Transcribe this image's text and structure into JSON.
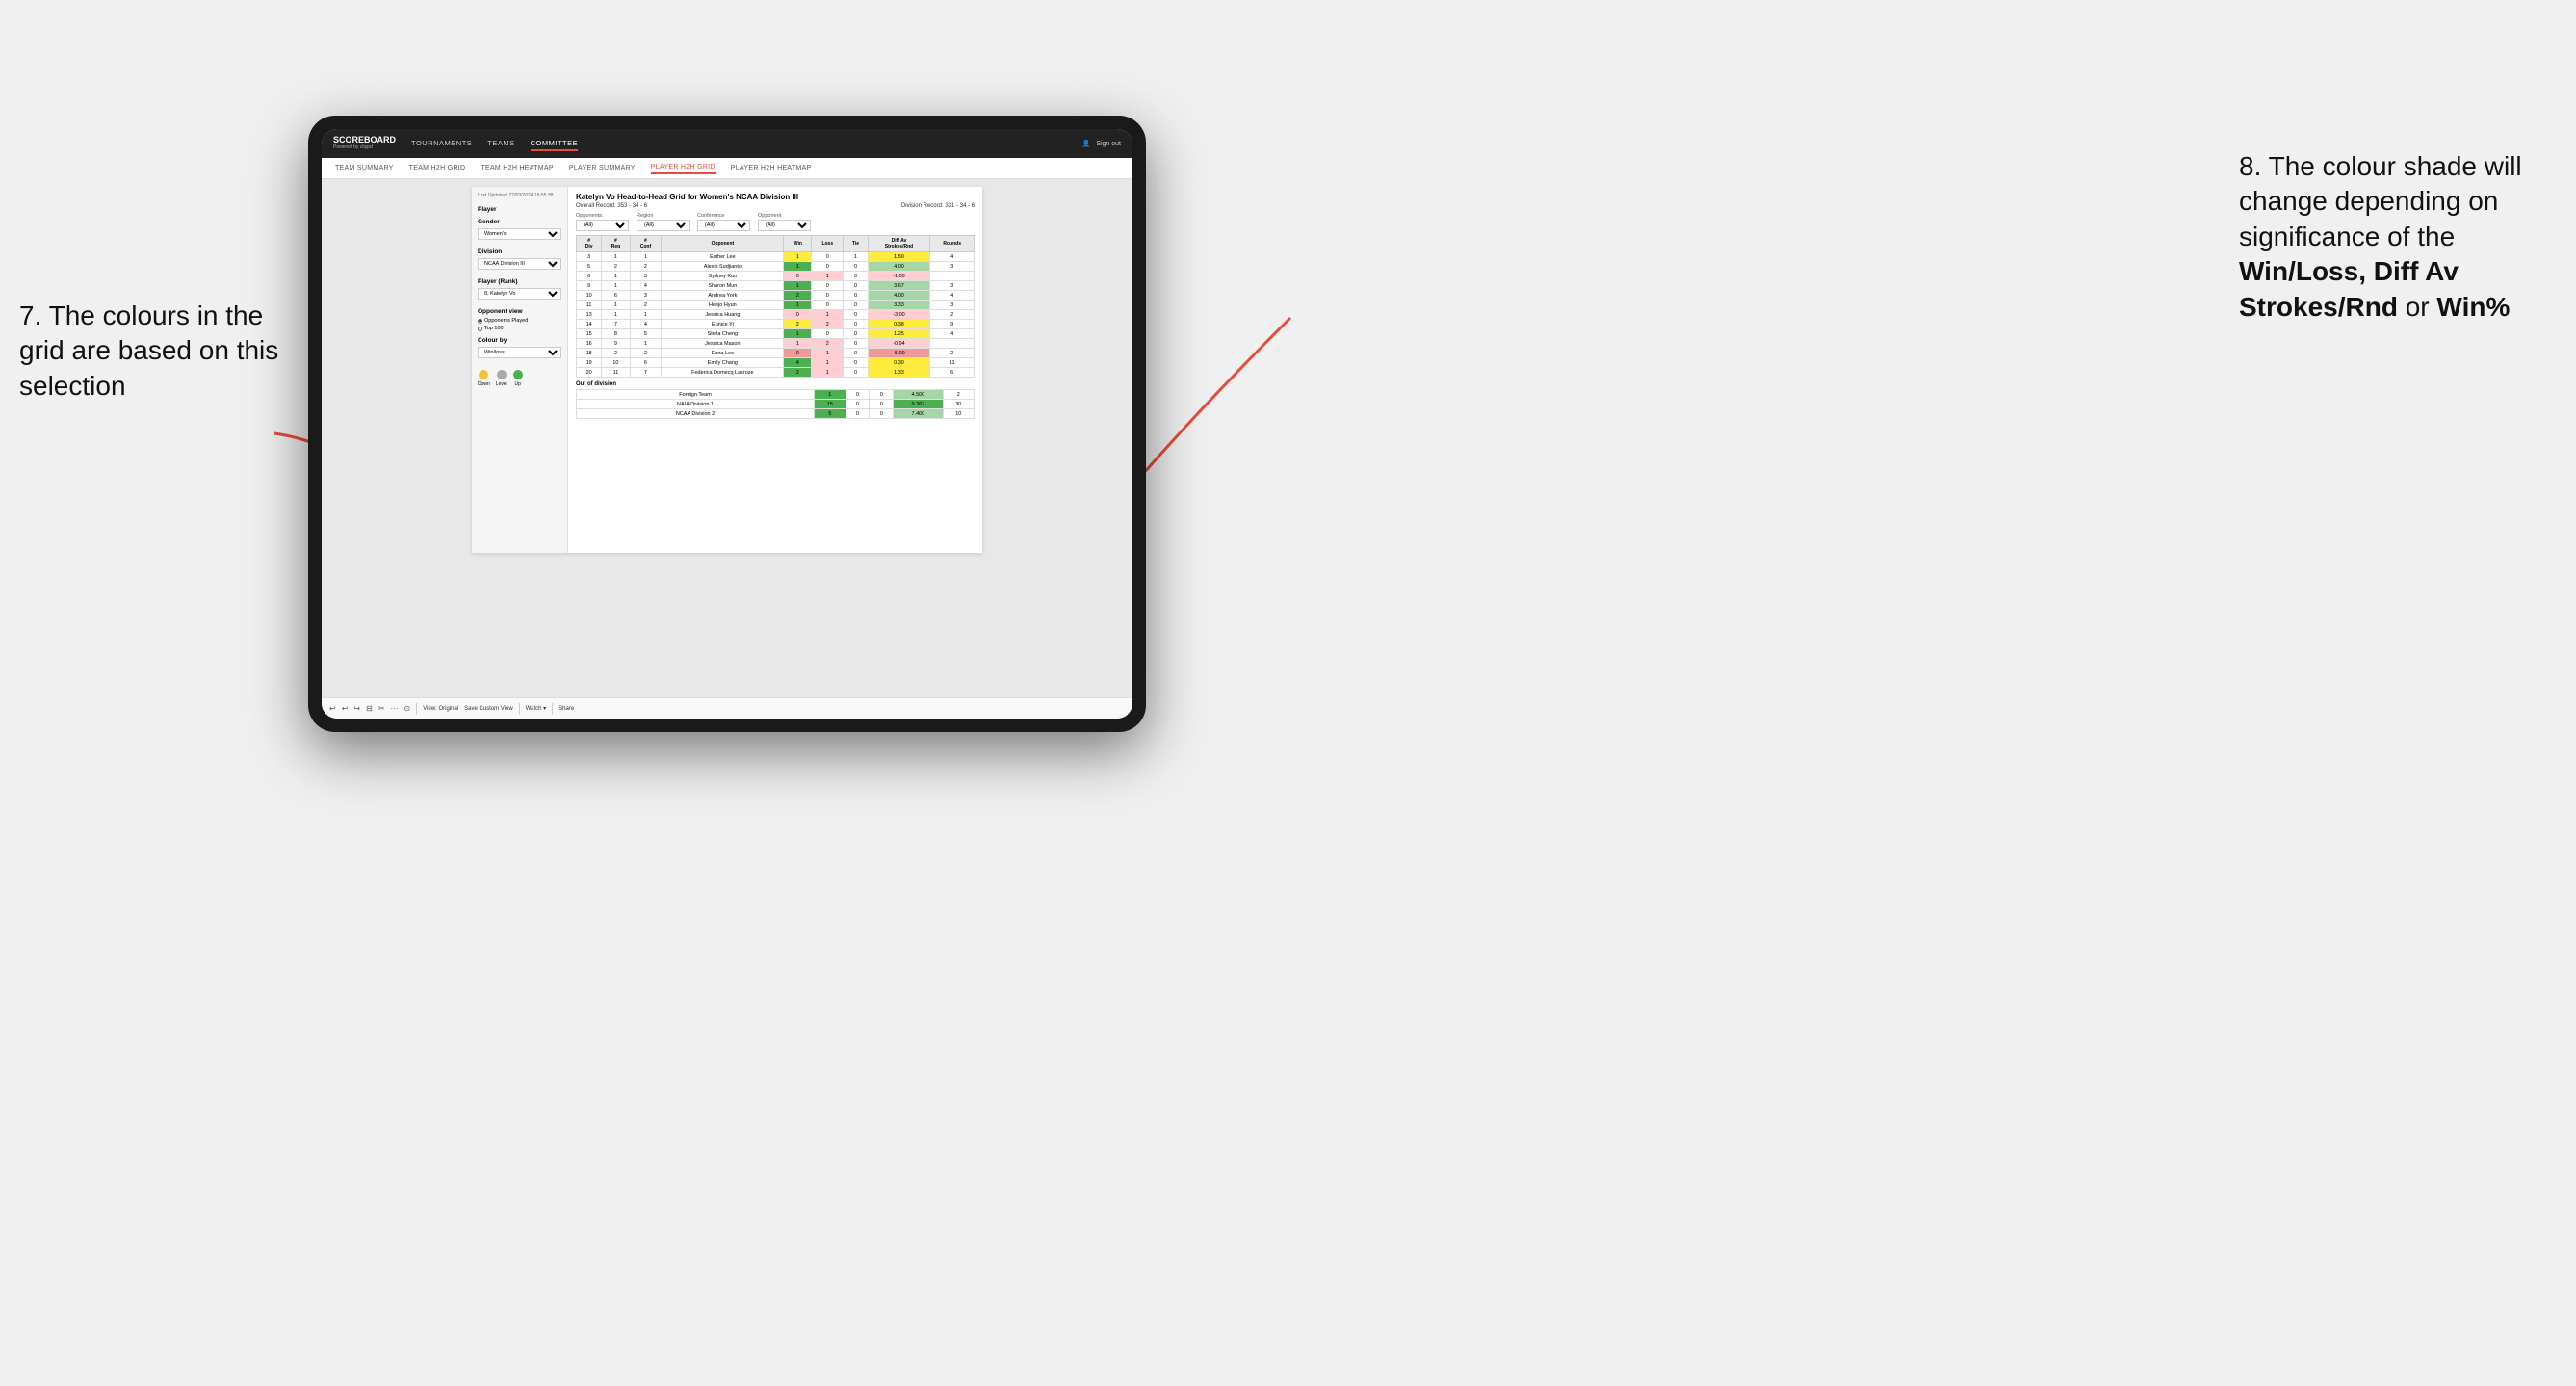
{
  "annotations": {
    "left_title": "7. The colours in the grid are based on this selection",
    "right_title": "8. The colour shade will change depending on significance of the",
    "right_bold1": "Win/Loss,",
    "right_bold2": "Diff Av Strokes/Rnd",
    "right_bold3": "or",
    "right_bold4": "Win%"
  },
  "nav": {
    "logo": "SCOREBOARD",
    "powered": "Powered by clippd",
    "links": [
      "TOURNAMENTS",
      "TEAMS",
      "COMMITTEE"
    ],
    "active_link": "COMMITTEE",
    "sign_in": "Sign out"
  },
  "sub_nav": {
    "links": [
      "TEAM SUMMARY",
      "TEAM H2H GRID",
      "TEAM H2H HEATMAP",
      "PLAYER SUMMARY",
      "PLAYER H2H GRID",
      "PLAYER H2H HEATMAP"
    ],
    "active": "PLAYER H2H GRID"
  },
  "sidebar": {
    "timestamp": "Last Updated: 27/03/2024 16:55:38",
    "sections": {
      "player": "Player",
      "gender_label": "Gender",
      "gender_value": "Women's",
      "division_label": "Division",
      "division_value": "NCAA Division III",
      "player_rank_label": "Player (Rank)",
      "player_rank_value": "8. Katelyn Vo"
    },
    "opponent_view": {
      "label": "Opponent view",
      "options": [
        "Opponents Played",
        "Top 100"
      ],
      "selected": "Opponents Played"
    },
    "colour_by": {
      "label": "Colour by",
      "value": "Win/loss"
    },
    "legend": {
      "items": [
        {
          "color": "#f4c430",
          "label": "Down"
        },
        {
          "color": "#aaaaaa",
          "label": "Level"
        },
        {
          "color": "#4CAF50",
          "label": "Up"
        }
      ]
    }
  },
  "report": {
    "title": "Katelyn Vo Head-to-Head Grid for Women's NCAA Division III",
    "overall_record_label": "Overall Record:",
    "overall_record": "353 - 34 - 6",
    "division_record_label": "Division Record:",
    "division_record": "331 - 34 - 6",
    "filters": {
      "opponents_label": "Opponents:",
      "opponents_value": "(All)",
      "region_label": "Region",
      "region_value": "(All)",
      "conference_label": "Conference",
      "conference_value": "(All)",
      "opponent_label": "Opponent",
      "opponent_value": "(All)"
    },
    "table_headers": [
      "#\nDiv",
      "#\nReg",
      "#\nConf",
      "Opponent",
      "Win",
      "Loss",
      "Tie",
      "Diff Av\nStrokes/Rnd",
      "Rounds"
    ],
    "rows": [
      {
        "div": 3,
        "reg": 1,
        "conf": 1,
        "opponent": "Esther Lee",
        "win": 1,
        "loss": 0,
        "tie": 1,
        "diff": "1.50",
        "rounds": 4,
        "win_color": "yellow",
        "diff_color": "yellow"
      },
      {
        "div": 5,
        "reg": 2,
        "conf": 2,
        "opponent": "Alexis Sudjianto",
        "win": 1,
        "loss": 0,
        "tie": 0,
        "diff": "4.00",
        "rounds": 3,
        "win_color": "green-dark",
        "diff_color": "green-light"
      },
      {
        "div": 6,
        "reg": 1,
        "conf": 3,
        "opponent": "Sydney Kuo",
        "win": 0,
        "loss": 1,
        "tie": 0,
        "diff": "-1.00",
        "rounds": "",
        "win_color": "red-light",
        "diff_color": "red-light"
      },
      {
        "div": 9,
        "reg": 1,
        "conf": 4,
        "opponent": "Sharon Mun",
        "win": 1,
        "loss": 0,
        "tie": 0,
        "diff": "3.67",
        "rounds": 3,
        "win_color": "green-dark",
        "diff_color": "green-light"
      },
      {
        "div": 10,
        "reg": 6,
        "conf": 3,
        "opponent": "Andrea York",
        "win": 2,
        "loss": 0,
        "tie": 0,
        "diff": "4.00",
        "rounds": 4,
        "win_color": "green-dark",
        "diff_color": "green-light"
      },
      {
        "div": 11,
        "reg": 1,
        "conf": 2,
        "opponent": "Heejo Hyun",
        "win": 1,
        "loss": 0,
        "tie": 0,
        "diff": "3.33",
        "rounds": 3,
        "win_color": "green-dark",
        "diff_color": "green-light"
      },
      {
        "div": 13,
        "reg": 1,
        "conf": 1,
        "opponent": "Jessica Huang",
        "win": 0,
        "loss": 1,
        "tie": 0,
        "diff": "-3.00",
        "rounds": 2,
        "win_color": "red-light",
        "diff_color": "red-light"
      },
      {
        "div": 14,
        "reg": 7,
        "conf": 4,
        "opponent": "Eunice Yi",
        "win": 2,
        "loss": 2,
        "tie": 0,
        "diff": "0.38",
        "rounds": 9,
        "win_color": "yellow",
        "diff_color": "yellow"
      },
      {
        "div": 15,
        "reg": 8,
        "conf": 5,
        "opponent": "Stella Cheng",
        "win": 1,
        "loss": 0,
        "tie": 0,
        "diff": "1.25",
        "rounds": 4,
        "win_color": "green-dark",
        "diff_color": "yellow"
      },
      {
        "div": 16,
        "reg": 9,
        "conf": 1,
        "opponent": "Jessica Mason",
        "win": 1,
        "loss": 2,
        "tie": 0,
        "diff": "-0.94",
        "rounds": "",
        "win_color": "red-light",
        "diff_color": "red-light"
      },
      {
        "div": 18,
        "reg": 2,
        "conf": 2,
        "opponent": "Euna Lee",
        "win": 0,
        "loss": 1,
        "tie": 0,
        "diff": "-5.00",
        "rounds": 2,
        "win_color": "red",
        "diff_color": "red"
      },
      {
        "div": 19,
        "reg": 10,
        "conf": 6,
        "opponent": "Emily Chang",
        "win": 4,
        "loss": 1,
        "tie": 0,
        "diff": "0.30",
        "rounds": 11,
        "win_color": "green-dark",
        "diff_color": "yellow"
      },
      {
        "div": 20,
        "reg": 11,
        "conf": 7,
        "opponent": "Federica Domecq Lacroze",
        "win": 2,
        "loss": 1,
        "tie": 0,
        "diff": "1.33",
        "rounds": 6,
        "win_color": "green-dark",
        "diff_color": "yellow"
      }
    ],
    "out_of_division": {
      "label": "Out of division",
      "rows": [
        {
          "name": "Foreign Team",
          "win": 1,
          "loss": 0,
          "tie": 0,
          "diff": "4.500",
          "rounds": 2,
          "win_color": "green-dark",
          "diff_color": "green-light"
        },
        {
          "name": "NAIA Division 1",
          "win": 15,
          "loss": 0,
          "tie": 0,
          "diff": "9.267",
          "rounds": 30,
          "win_color": "green-dark",
          "diff_color": "green-dark"
        },
        {
          "name": "NCAA Division 2",
          "win": 5,
          "loss": 0,
          "tie": 0,
          "diff": "7.400",
          "rounds": 10,
          "win_color": "green-dark",
          "diff_color": "green-light"
        }
      ]
    }
  },
  "toolbar": {
    "buttons": [
      "↩",
      "↩",
      "↪",
      "⊟",
      "✂",
      "·",
      "⊙",
      "|",
      "View: Original",
      "Save Custom View",
      "Watch ▾",
      "|",
      "Share"
    ],
    "view_original": "View: Original",
    "save_custom": "Save Custom View",
    "watch": "Watch ▾",
    "share": "Share"
  }
}
